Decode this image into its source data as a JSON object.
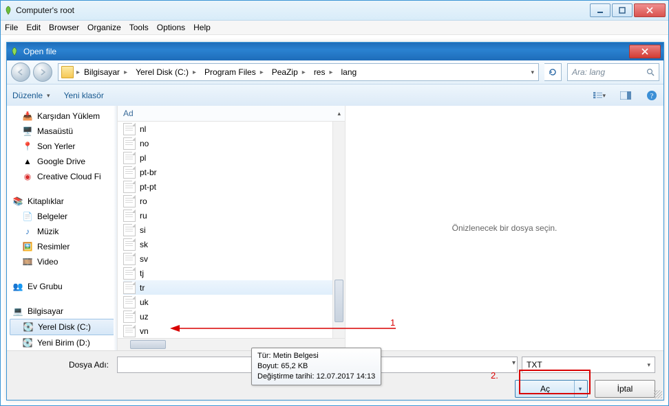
{
  "outer": {
    "title": "Computer's root"
  },
  "menu": {
    "file": "File",
    "edit": "Edit",
    "browser": "Browser",
    "organize": "Organize",
    "tools": "Tools",
    "options": "Options",
    "help": "Help"
  },
  "dialog": {
    "title": "Open file"
  },
  "breadcrumb": {
    "items": [
      "Bilgisayar",
      "Yerel Disk (C:)",
      "Program Files",
      "PeaZip",
      "res",
      "lang"
    ]
  },
  "search": {
    "placeholder": "Ara: lang"
  },
  "toolbar": {
    "organize": "Düzenle",
    "newfolder": "Yeni klasör"
  },
  "sidebar": {
    "fav": [
      {
        "label": "Karşıdan Yüklem",
        "icon": "download"
      },
      {
        "label": "Masaüstü",
        "icon": "desktop"
      },
      {
        "label": "Son Yerler",
        "icon": "recent"
      },
      {
        "label": "Google Drive",
        "icon": "gdrive"
      },
      {
        "label": "Creative Cloud Fi",
        "icon": "cc"
      }
    ],
    "lib_title": "Kitaplıklar",
    "lib": [
      {
        "label": "Belgeler",
        "icon": "doc"
      },
      {
        "label": "Müzik",
        "icon": "music"
      },
      {
        "label": "Resimler",
        "icon": "pic"
      },
      {
        "label": "Video",
        "icon": "vid"
      }
    ],
    "homegroup": "Ev Grubu",
    "computer": "Bilgisayar",
    "drives": [
      {
        "label": "Yerel Disk (C:)",
        "sel": true
      },
      {
        "label": "Yeni Birim (D:)",
        "sel": false
      }
    ]
  },
  "filelist": {
    "header": "Ad",
    "rows": [
      "nl",
      "no",
      "pl",
      "pt-br",
      "pt-pt",
      "ro",
      "ru",
      "si",
      "sk",
      "sv",
      "tj",
      "tr",
      "uk",
      "uz",
      "vn"
    ],
    "selected": "tr"
  },
  "preview": {
    "empty": "Önizlenecek bir dosya seçin."
  },
  "tooltip": {
    "l1": "Tür: Metin Belgesi",
    "l2": "Boyut: 65,2 KB",
    "l3": "Değiştirme tarihi: 12.07.2017 14:13"
  },
  "annotations": {
    "a1": "1",
    "a2": "2."
  },
  "footer": {
    "filename_label": "Dosya Adı:",
    "type": "TXT",
    "open": "Aç",
    "cancel": "İptal"
  }
}
